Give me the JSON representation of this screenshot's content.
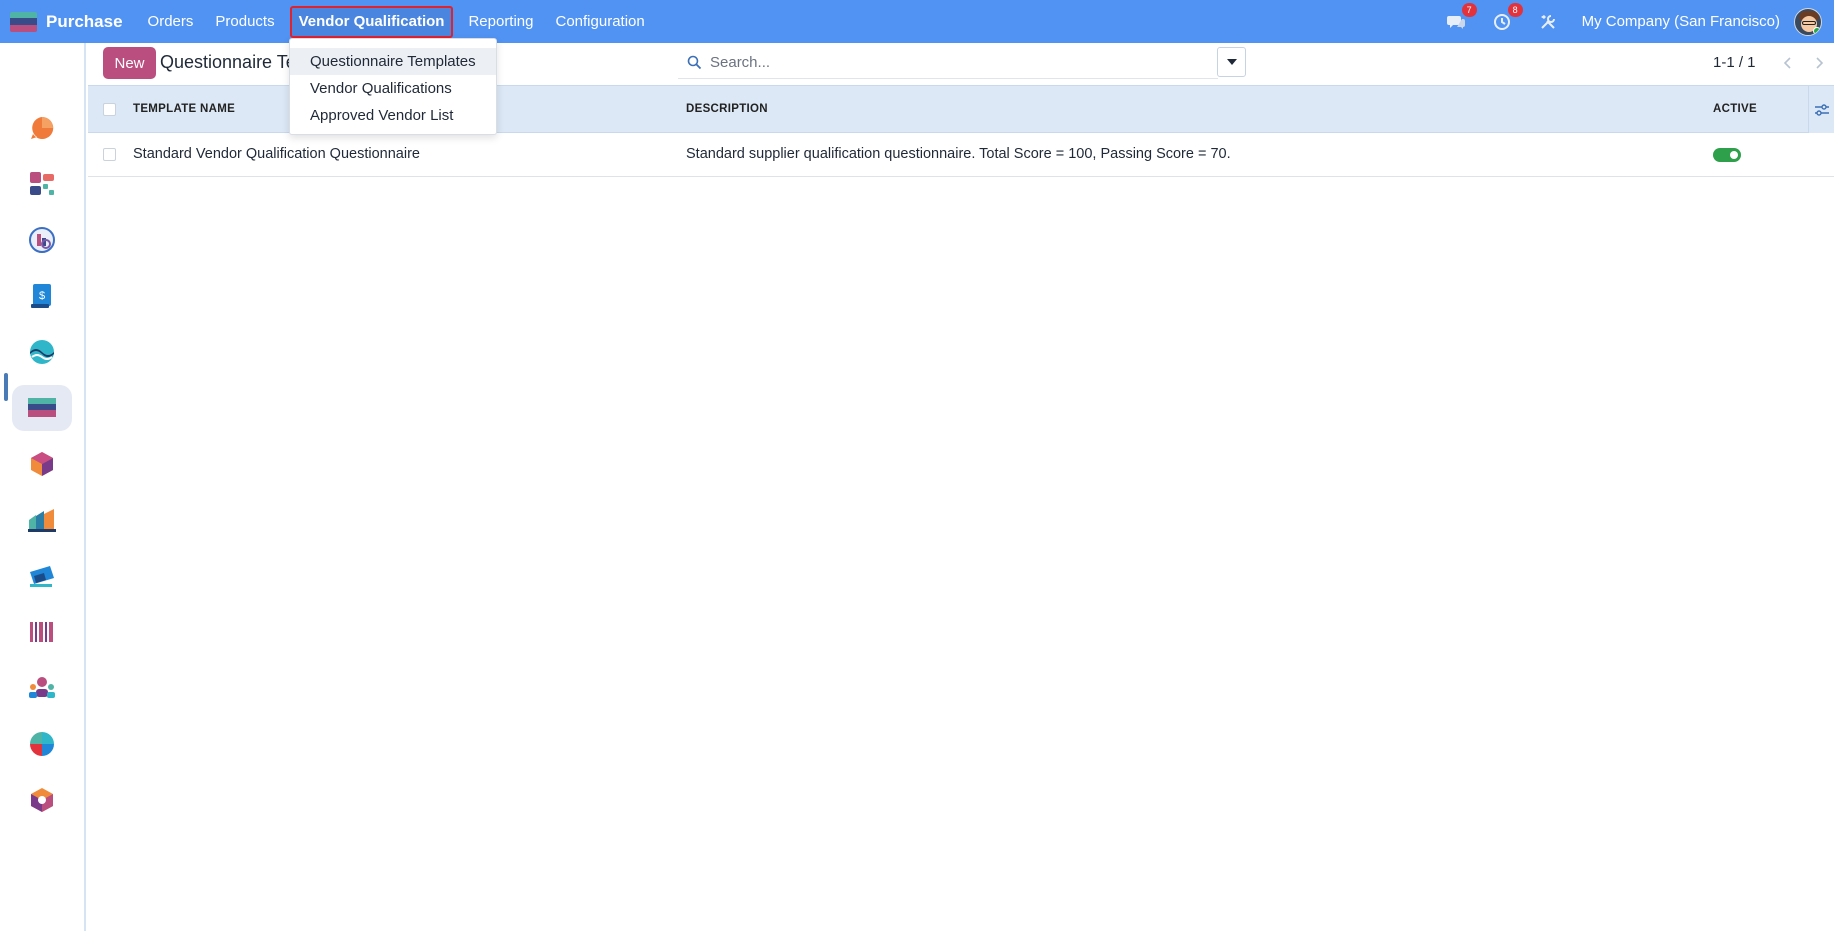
{
  "app": {
    "name": "Purchase",
    "brand_colors": [
      "#4fb3a5",
      "#3a4b8a",
      "#b94e7f"
    ]
  },
  "menu": {
    "items": [
      {
        "label": "Orders"
      },
      {
        "label": "Products"
      },
      {
        "label": "Vendor Qualification",
        "active": true
      },
      {
        "label": "Reporting"
      },
      {
        "label": "Configuration"
      }
    ],
    "dropdown": [
      {
        "label": "Questionnaire Templates"
      },
      {
        "label": "Vendor Qualifications"
      },
      {
        "label": "Approved Vendor List"
      }
    ]
  },
  "systray": {
    "messages_count": "7",
    "activities_count": "8",
    "company": "My Company (San Francisco)"
  },
  "sidebar": {
    "apps": [
      {
        "icon": "discuss-app-icon"
      },
      {
        "icon": "dashboard-app-icon"
      },
      {
        "icon": "crm-app-icon"
      },
      {
        "icon": "invoicing-app-icon"
      },
      {
        "icon": "website-app-icon"
      },
      {
        "icon": "purchase-app-icon",
        "active": true
      },
      {
        "icon": "inventory-app-icon"
      },
      {
        "icon": "manufacturing-app-icon"
      },
      {
        "icon": "marketing-app-icon"
      },
      {
        "icon": "barcode-app-icon"
      },
      {
        "icon": "employees-app-icon"
      },
      {
        "icon": "planning-app-icon"
      },
      {
        "icon": "apps-app-icon"
      }
    ]
  },
  "control": {
    "new_label": "New",
    "breadcrumb": "Questionnaire Templates",
    "search_placeholder": "Search...",
    "pager": "1-1 / 1"
  },
  "table": {
    "headers": {
      "name": "TEMPLATE NAME",
      "description": "DESCRIPTION",
      "active": "ACTIVE"
    },
    "rows": [
      {
        "name": "Standard Vendor Qualification Questionnaire",
        "description": "Standard supplier qualification questionnaire. Total Score = 100, Passing Score = 70.",
        "active": true
      }
    ]
  }
}
